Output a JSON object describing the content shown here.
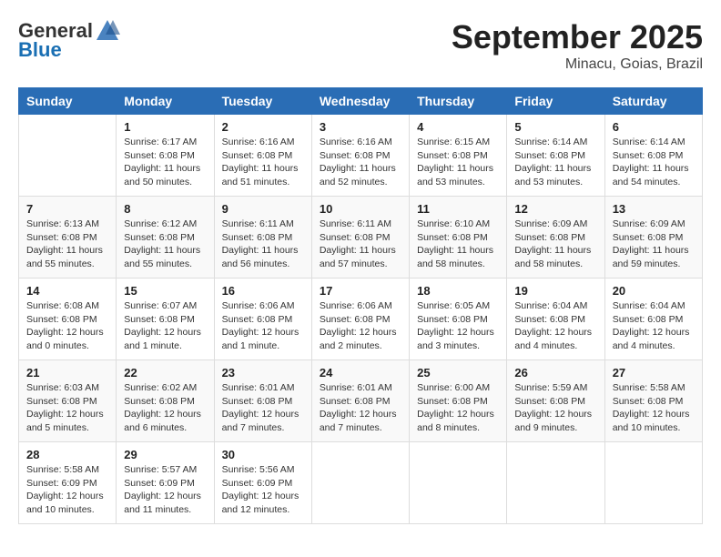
{
  "header": {
    "logo_general": "General",
    "logo_blue": "Blue",
    "month_title": "September 2025",
    "location": "Minacu, Goias, Brazil"
  },
  "weekdays": [
    "Sunday",
    "Monday",
    "Tuesday",
    "Wednesday",
    "Thursday",
    "Friday",
    "Saturday"
  ],
  "weeks": [
    [
      {
        "day": "",
        "info": ""
      },
      {
        "day": "1",
        "info": "Sunrise: 6:17 AM\nSunset: 6:08 PM\nDaylight: 11 hours\nand 50 minutes."
      },
      {
        "day": "2",
        "info": "Sunrise: 6:16 AM\nSunset: 6:08 PM\nDaylight: 11 hours\nand 51 minutes."
      },
      {
        "day": "3",
        "info": "Sunrise: 6:16 AM\nSunset: 6:08 PM\nDaylight: 11 hours\nand 52 minutes."
      },
      {
        "day": "4",
        "info": "Sunrise: 6:15 AM\nSunset: 6:08 PM\nDaylight: 11 hours\nand 53 minutes."
      },
      {
        "day": "5",
        "info": "Sunrise: 6:14 AM\nSunset: 6:08 PM\nDaylight: 11 hours\nand 53 minutes."
      },
      {
        "day": "6",
        "info": "Sunrise: 6:14 AM\nSunset: 6:08 PM\nDaylight: 11 hours\nand 54 minutes."
      }
    ],
    [
      {
        "day": "7",
        "info": "Sunrise: 6:13 AM\nSunset: 6:08 PM\nDaylight: 11 hours\nand 55 minutes."
      },
      {
        "day": "8",
        "info": "Sunrise: 6:12 AM\nSunset: 6:08 PM\nDaylight: 11 hours\nand 55 minutes."
      },
      {
        "day": "9",
        "info": "Sunrise: 6:11 AM\nSunset: 6:08 PM\nDaylight: 11 hours\nand 56 minutes."
      },
      {
        "day": "10",
        "info": "Sunrise: 6:11 AM\nSunset: 6:08 PM\nDaylight: 11 hours\nand 57 minutes."
      },
      {
        "day": "11",
        "info": "Sunrise: 6:10 AM\nSunset: 6:08 PM\nDaylight: 11 hours\nand 58 minutes."
      },
      {
        "day": "12",
        "info": "Sunrise: 6:09 AM\nSunset: 6:08 PM\nDaylight: 11 hours\nand 58 minutes."
      },
      {
        "day": "13",
        "info": "Sunrise: 6:09 AM\nSunset: 6:08 PM\nDaylight: 11 hours\nand 59 minutes."
      }
    ],
    [
      {
        "day": "14",
        "info": "Sunrise: 6:08 AM\nSunset: 6:08 PM\nDaylight: 12 hours\nand 0 minutes."
      },
      {
        "day": "15",
        "info": "Sunrise: 6:07 AM\nSunset: 6:08 PM\nDaylight: 12 hours\nand 1 minute."
      },
      {
        "day": "16",
        "info": "Sunrise: 6:06 AM\nSunset: 6:08 PM\nDaylight: 12 hours\nand 1 minute."
      },
      {
        "day": "17",
        "info": "Sunrise: 6:06 AM\nSunset: 6:08 PM\nDaylight: 12 hours\nand 2 minutes."
      },
      {
        "day": "18",
        "info": "Sunrise: 6:05 AM\nSunset: 6:08 PM\nDaylight: 12 hours\nand 3 minutes."
      },
      {
        "day": "19",
        "info": "Sunrise: 6:04 AM\nSunset: 6:08 PM\nDaylight: 12 hours\nand 4 minutes."
      },
      {
        "day": "20",
        "info": "Sunrise: 6:04 AM\nSunset: 6:08 PM\nDaylight: 12 hours\nand 4 minutes."
      }
    ],
    [
      {
        "day": "21",
        "info": "Sunrise: 6:03 AM\nSunset: 6:08 PM\nDaylight: 12 hours\nand 5 minutes."
      },
      {
        "day": "22",
        "info": "Sunrise: 6:02 AM\nSunset: 6:08 PM\nDaylight: 12 hours\nand 6 minutes."
      },
      {
        "day": "23",
        "info": "Sunrise: 6:01 AM\nSunset: 6:08 PM\nDaylight: 12 hours\nand 7 minutes."
      },
      {
        "day": "24",
        "info": "Sunrise: 6:01 AM\nSunset: 6:08 PM\nDaylight: 12 hours\nand 7 minutes."
      },
      {
        "day": "25",
        "info": "Sunrise: 6:00 AM\nSunset: 6:08 PM\nDaylight: 12 hours\nand 8 minutes."
      },
      {
        "day": "26",
        "info": "Sunrise: 5:59 AM\nSunset: 6:08 PM\nDaylight: 12 hours\nand 9 minutes."
      },
      {
        "day": "27",
        "info": "Sunrise: 5:58 AM\nSunset: 6:08 PM\nDaylight: 12 hours\nand 10 minutes."
      }
    ],
    [
      {
        "day": "28",
        "info": "Sunrise: 5:58 AM\nSunset: 6:09 PM\nDaylight: 12 hours\nand 10 minutes."
      },
      {
        "day": "29",
        "info": "Sunrise: 5:57 AM\nSunset: 6:09 PM\nDaylight: 12 hours\nand 11 minutes."
      },
      {
        "day": "30",
        "info": "Sunrise: 5:56 AM\nSunset: 6:09 PM\nDaylight: 12 hours\nand 12 minutes."
      },
      {
        "day": "",
        "info": ""
      },
      {
        "day": "",
        "info": ""
      },
      {
        "day": "",
        "info": ""
      },
      {
        "day": "",
        "info": ""
      }
    ]
  ]
}
